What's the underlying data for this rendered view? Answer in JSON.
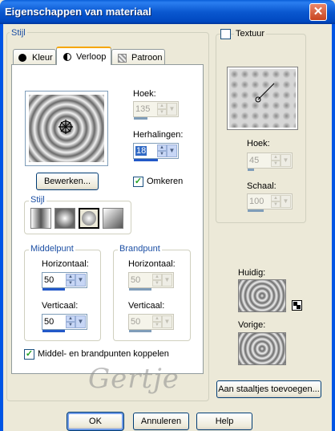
{
  "window": {
    "title": "Eigenschappen van materiaal",
    "close_glyph": "✕"
  },
  "left_group": {
    "label": "Stijl"
  },
  "tabs": [
    {
      "label": "Kleur"
    },
    {
      "label": "Verloop"
    },
    {
      "label": "Patroon"
    }
  ],
  "gradient": {
    "edit_button": "Bewerken...",
    "angle": {
      "label": "Hoek:",
      "value": "135",
      "disabled": true
    },
    "repeats": {
      "label": "Herhalingen:",
      "value": "18",
      "disabled": false
    },
    "invert": {
      "label": "Omkeren",
      "checked": true
    },
    "style_group": {
      "label": "Stijl",
      "styles": [
        "linear",
        "rectangular",
        "sunburst",
        "radial"
      ],
      "selected": "sunburst"
    }
  },
  "center_point": {
    "label": "Middelpunt",
    "horizontal": {
      "label": "Horizontaal:",
      "value": "50"
    },
    "vertical": {
      "label": "Verticaal:",
      "value": "50"
    }
  },
  "focal_point": {
    "label": "Brandpunt",
    "horizontal": {
      "label": "Horizontaal:",
      "value": "50",
      "disabled": true
    },
    "vertical": {
      "label": "Verticaal:",
      "value": "50",
      "disabled": true
    }
  },
  "link_points": {
    "label": "Middel- en brandpunten koppelen",
    "checked": true
  },
  "watermark": {
    "text": "Gertje"
  },
  "texture": {
    "label": "Textuur",
    "checked": false,
    "angle": {
      "label": "Hoek:",
      "value": "45",
      "disabled": true
    },
    "scale": {
      "label": "Schaal:",
      "value": "100",
      "disabled": true
    }
  },
  "current": {
    "label": "Huidig:"
  },
  "previous": {
    "label": "Vorige:"
  },
  "add_swatch_button": "Aan staaltjes toevoegen...",
  "footer": {
    "ok": "OK",
    "cancel": "Annuleren",
    "help": "Help"
  },
  "colors": {
    "title_bar": "#0a58d0",
    "frame": "#0055e5",
    "dialog_bg": "#ece9d8",
    "group_label": "#1c4fa4",
    "tab_highlight": "#f6a600",
    "check": "#21a121"
  }
}
